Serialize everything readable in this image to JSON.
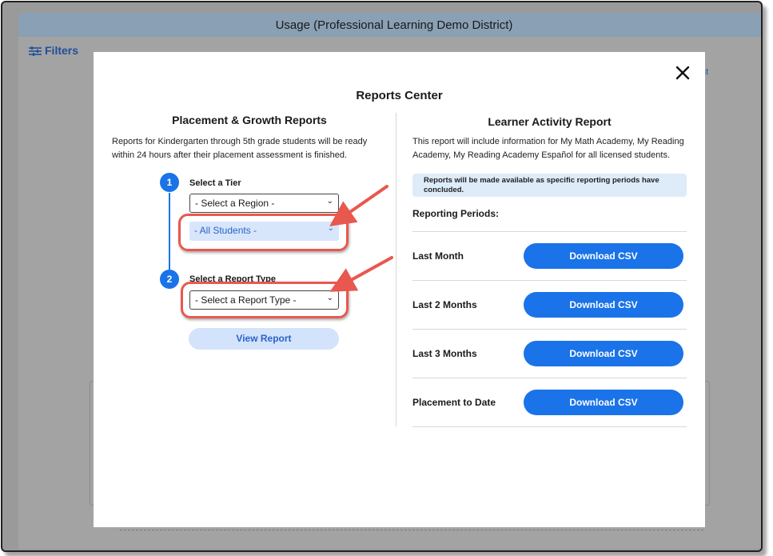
{
  "app": {
    "title": "Usage (Professional Learning Demo District)"
  },
  "background": {
    "filters_label": "Filters",
    "partial_link": "nt"
  },
  "modal": {
    "title": "Reports Center",
    "placement": {
      "title": "Placement & Growth Reports",
      "description": "Reports for Kindergarten through 5th grade students will be ready within 24 hours after their placement assessment is finished.",
      "step1": {
        "number": "1",
        "label": "Select a Tier",
        "region_value": "- Select a Region -",
        "students_value": "- All Students -"
      },
      "step2": {
        "number": "2",
        "label": "Select a Report Type",
        "report_value": "- Select a Report Type -"
      },
      "view_button": "View Report"
    },
    "activity": {
      "title": "Learner Activity Report",
      "description": "This report will include information for My Math Academy, My Reading Academy, My Reading Academy Español for all licensed students.",
      "notice": "Reports will be made available as specific reporting periods have concluded.",
      "periods_label": "Reporting Periods:",
      "rows": [
        {
          "label": "Last Month",
          "button": "Download CSV"
        },
        {
          "label": "Last 2 Months",
          "button": "Download CSV"
        },
        {
          "label": "Last 3 Months",
          "button": "Download CSV"
        },
        {
          "label": "Placement to Date",
          "button": "Download CSV"
        }
      ]
    }
  },
  "colors": {
    "accent": "#1a73e8",
    "callout": "#e8584f",
    "overlay": "#9a9a9a"
  }
}
